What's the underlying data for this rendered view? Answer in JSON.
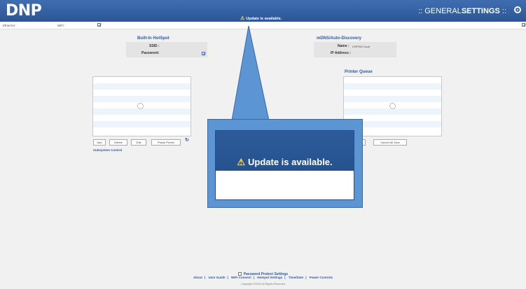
{
  "header": {
    "logo": "DNP",
    "alert_text": "Update is available.",
    "title_prefix": ":: GENERAL",
    "title_bold": "SETTINGS",
    "title_suffix": " ::",
    "icons": {
      "warning": "warning-icon",
      "settings": "gear-icon"
    }
  },
  "subbar": {
    "ethernet_label": "Ethernet :",
    "wifi_label": "WiFi :"
  },
  "hotspot": {
    "title": "Built-In HotSpot",
    "ssid_label": "SSID :",
    "password_label": "Password:"
  },
  "mdns": {
    "title": "mDNS/Auto-Discovery",
    "name_label": "Name :",
    "name_value": "DNPWIZ.local",
    "ip_label": "IP Address :"
  },
  "left_panel": {
    "buttons": [
      "Add",
      "Delete",
      "Edit",
      "Pause Printer"
    ],
    "link": "Subsystem Control"
  },
  "printer_queue": {
    "title": "Printer Queue",
    "cancel_label": "Cancel All Jobs"
  },
  "callout": {
    "text": "Update is available."
  },
  "footer": {
    "password_protect": "Password Protect Settings",
    "links": [
      "About",
      "User Guide",
      "WiFi Connect",
      "Hotspot Settings",
      "Time/Date",
      "Power Controls"
    ],
    "copyright": "Copyright ©2020 All Rights Reserved"
  },
  "colors": {
    "header": "#2c5597",
    "accent": "#2d5aa0",
    "callout": "#5b95d4",
    "row_alt": "#edf4fc",
    "warning": "#ffd52e"
  }
}
